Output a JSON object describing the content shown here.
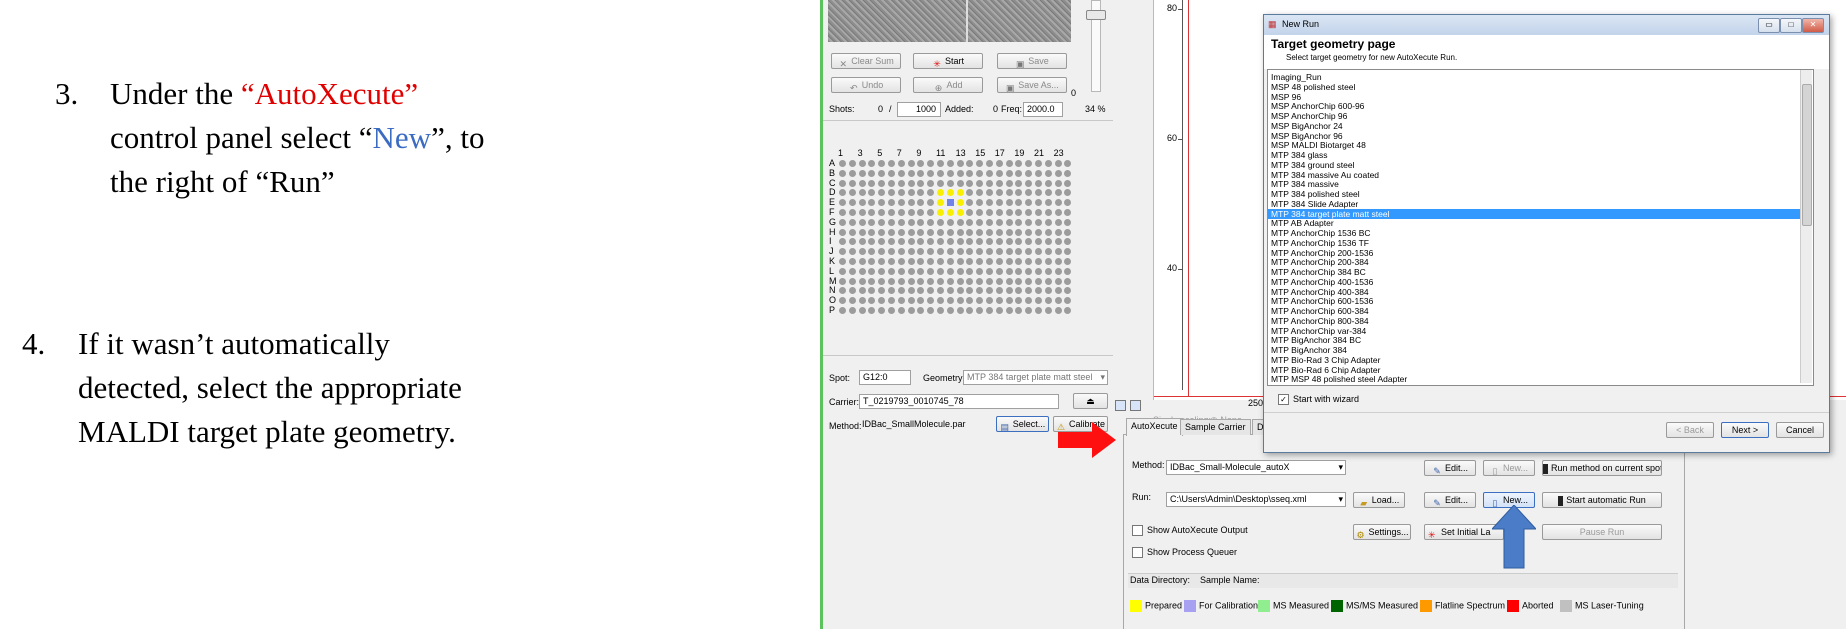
{
  "slide": {
    "step3": {
      "number": "3.",
      "line1_pre": "Under the ",
      "line1_highlight": "“AutoXecute”",
      "line2_pre": "control panel select “",
      "line2_highlight": "New",
      "line2_post": "”, to",
      "line3": "the right of “Run”",
      "highlight_colors": {
        "autoxecute": "#e00000",
        "new": "#3b6cc2"
      }
    },
    "step4": {
      "number": "4.",
      "line1": "If it wasn’t automatically",
      "line2": "detected, select the appropriate",
      "line3": "MALDI target plate geometry."
    }
  },
  "acquisition": {
    "buttons": {
      "clear_sum": "Clear Sum",
      "start": "Start",
      "save": "Save",
      "undo": "Undo",
      "add": "Add",
      "save_as": "Save As..."
    },
    "shots_label": "Shots:",
    "shots_value": "0",
    "shots_sep": "/",
    "shots_total": "1000",
    "added_label": "Added:",
    "added_value": "0",
    "freq_label": "Freq:",
    "freq_value": "2000.0",
    "laser_percent": "34 %",
    "slider_value": "0"
  },
  "plate": {
    "column_labels": [
      "1",
      "3",
      "5",
      "7",
      "9",
      "11",
      "13",
      "15",
      "17",
      "19",
      "21",
      "23"
    ],
    "row_labels": [
      "A",
      "B",
      "C",
      "D",
      "E",
      "F",
      "G",
      "H",
      "I",
      "J",
      "K",
      "L",
      "M",
      "N",
      "O",
      "P"
    ],
    "highlighted_rows": [
      "D",
      "E",
      "F"
    ],
    "highlighted_cols": [
      11,
      12,
      13
    ],
    "selected_spot": "E12",
    "highlight_color": "#f8f000",
    "selected_color": "#6f83e8"
  },
  "spot_panel": {
    "spot_label": "Spot:",
    "spot_value": "G12:0",
    "geometry_label": "Geometry:",
    "geometry_value": "MTP 384 target plate matt steel",
    "carrier_label": "Carrier:",
    "carrier_value": "T_0219793_0010745_78",
    "method_label": "Method:",
    "method_value": "IDBac_SmallMolecule.par",
    "select_button": "Select...",
    "calibrate_button": "Calibrate"
  },
  "chart": {
    "y_ticks": [
      "80",
      "60",
      "40"
    ],
    "x_tick": "250",
    "single_scaling_label": "Single scaling:",
    "none_label": "None"
  },
  "dialog": {
    "title": "New Run",
    "page_title": "Target geometry page",
    "subtitle": "Select target geometry for new AutoXecute Run.",
    "geometries": [
      "Imaging_Run",
      "MSP 48 polished steel",
      "MSP 96",
      "MSP AnchorChip 600-96",
      "MSP AnchorChip 96",
      "MSP BigAnchor 24",
      "MSP BigAnchor 96",
      "MSP MALDI Biotarget 48",
      "MTP 384 glass",
      "MTP 384 ground steel",
      "MTP 384 massive Au coated",
      "MTP 384 massive",
      "MTP 384 polished steel",
      "MTP 384 Slide Adapter",
      "MTP 384 target plate matt steel",
      "MTP AB Adapter",
      "MTP AnchorChip 1536 BC",
      "MTP AnchorChip 1536 TF",
      "MTP AnchorChip 200-1536",
      "MTP AnchorChip 200-384",
      "MTP AnchorChip 384 BC",
      "MTP AnchorChip 400-1536",
      "MTP AnchorChip 400-384",
      "MTP AnchorChip 600-1536",
      "MTP AnchorChip 600-384",
      "MTP AnchorChip 800-384",
      "MTP AnchorChip var-384",
      "MTP BigAnchor 384 BC",
      "MTP BigAnchor 384",
      "MTP Bio-Rad 3 Chip Adapter",
      "MTP Bio-Rad 6 Chip Adapter",
      "MTP MSP 48 polished steel Adapter"
    ],
    "selected_geometry": "MTP 384 target plate matt steel",
    "start_with_wizard": "Start with wizard",
    "back_button": "< Back",
    "next_button": "Next >",
    "cancel_button": "Cancel"
  },
  "autoxecute": {
    "tabs": [
      "AutoXecute",
      "Sample Carrier",
      "Detecti"
    ],
    "method_label": "Method:",
    "method_value": "IDBac_Small-Molecule_autoX",
    "run_label": "Run:",
    "run_value": "C:\\Users\\Admin\\Desktop\\sseq.xml",
    "edit_button": "Edit...",
    "new_button": "New...",
    "load_button": "Load...",
    "run_method_button": "Run method on current spot",
    "start_automatic_run": "Start automatic Run",
    "show_output": "Show AutoXecute Output",
    "show_queuer": "Show Process Queuer",
    "settings_button": "Settings...",
    "set_initial_button": "Set Initial La",
    "pause_run": "Pause Run",
    "data_directory_label": "Data Directory:",
    "sample_name_label": "Sample Name:",
    "legend": [
      {
        "label": "Prepared",
        "color": "#ffff00"
      },
      {
        "label": "For Calibration",
        "color": "#a8a0f0"
      },
      {
        "label": "MS Measured",
        "color": "#90ee90"
      },
      {
        "label": "MS/MS Measured",
        "color": "#006400"
      },
      {
        "label": "Flatline Spectrum",
        "color": "#ff9900"
      },
      {
        "label": "Aborted",
        "color": "#ff0000"
      },
      {
        "label": "MS Laser-Tuning",
        "color": "#c0c0c0"
      }
    ]
  },
  "annotations": {
    "red_arrow_color": "#ff1010",
    "blue_arrow_color": "#4a7cc8"
  }
}
